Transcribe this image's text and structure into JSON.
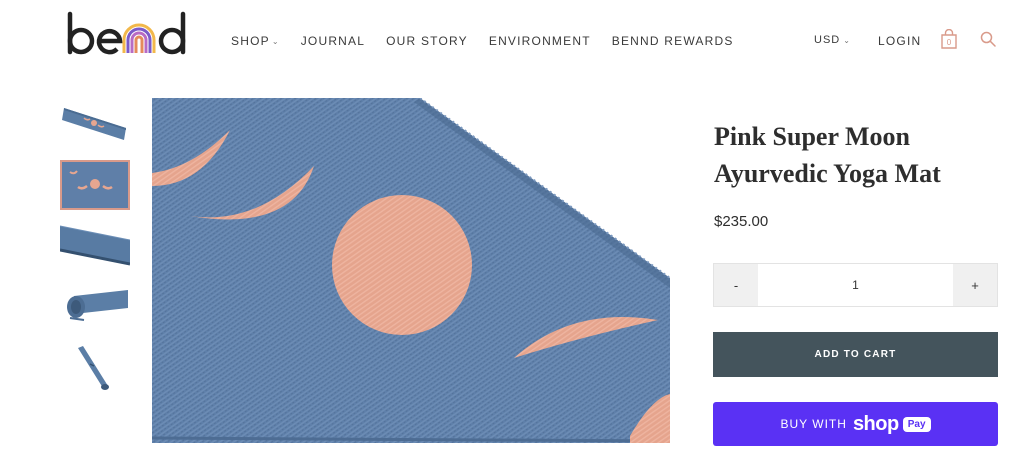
{
  "brand": {
    "logo_text": "bend",
    "accent_colors": [
      "#f2b84b",
      "#e48a5c",
      "#b86bc4",
      "#7b5ac9"
    ]
  },
  "nav": {
    "items": [
      {
        "label": "SHOP",
        "has_dropdown": true
      },
      {
        "label": "JOURNAL",
        "has_dropdown": false
      },
      {
        "label": "OUR STORY",
        "has_dropdown": false
      },
      {
        "label": "ENVIRONMENT",
        "has_dropdown": false
      },
      {
        "label": "BENND REWARDS",
        "has_dropdown": false
      }
    ],
    "currency": "USD",
    "login": "LOGIN",
    "cart_count": "0",
    "icons": [
      "shopping-bag-icon",
      "search-icon"
    ]
  },
  "gallery": {
    "thumbnails": [
      {
        "alt": "mat-full-view"
      },
      {
        "alt": "mat-moon-detail",
        "active": true
      },
      {
        "alt": "mat-edge-closeup"
      },
      {
        "alt": "mat-rolled"
      },
      {
        "alt": "mat-rolled-standing"
      }
    ]
  },
  "product": {
    "title": "Pink Super Moon Ayurvedic Yoga Mat",
    "price": "$235.00",
    "quantity": "1",
    "minus_label": "-",
    "plus_label": "+",
    "add_to_cart": "ADD TO CART",
    "buy_with_label": "BUY WITH",
    "shop_word": "shop",
    "pay_badge": "Pay"
  },
  "colors": {
    "mat_blue": "#5f7fa8",
    "moon_pink": "#e6a690",
    "add_to_cart_bg": "#44545c",
    "shop_pay_bg": "#5a31f4",
    "icon_accent": "#d99a8a"
  }
}
